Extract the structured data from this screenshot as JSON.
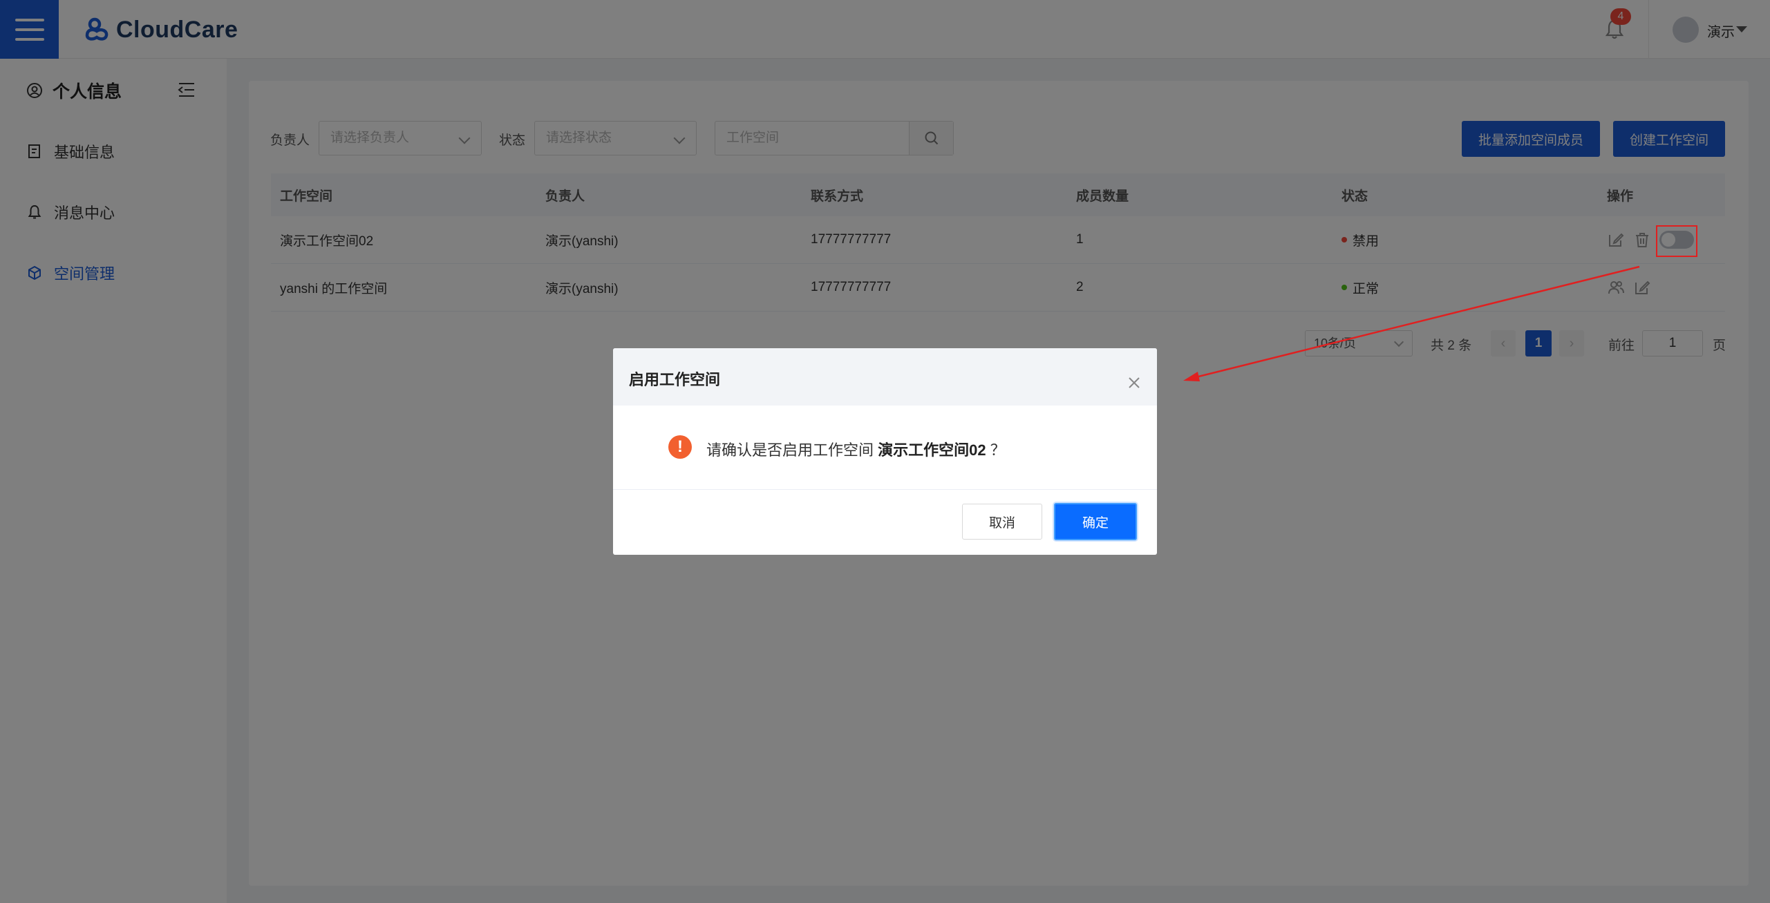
{
  "header": {
    "brand": "CloudCare",
    "notification_count": "4",
    "user_name": "演示"
  },
  "sidebar": {
    "title": "个人信息",
    "items": [
      {
        "label": "基础信息",
        "icon": "edit-doc-icon",
        "active": false
      },
      {
        "label": "消息中心",
        "icon": "bell-icon",
        "active": false
      },
      {
        "label": "空间管理",
        "icon": "cube-icon",
        "active": true
      }
    ]
  },
  "filters": {
    "owner_label": "负责人",
    "owner_placeholder": "请选择负责人",
    "status_label": "状态",
    "status_placeholder": "请选择状态",
    "search_placeholder": "工作空间"
  },
  "actions": {
    "batch_add_label": "批量添加空间成员",
    "create_label": "创建工作空间"
  },
  "table": {
    "columns": [
      "工作空间",
      "负责人",
      "联系方式",
      "成员数量",
      "状态",
      "操作"
    ],
    "rows": [
      {
        "workspace": "演示工作空间02",
        "owner": "演示(yanshi)",
        "contact": "17777777777",
        "members": "1",
        "status": "禁用",
        "status_color": "#f5483b"
      },
      {
        "workspace": "yanshi 的工作空间",
        "owner": "演示(yanshi)",
        "contact": "17777777777",
        "members": "2",
        "status": "正常",
        "status_color": "#52c41a"
      }
    ]
  },
  "pagination": {
    "page_size": "10条/页",
    "total": "共 2 条",
    "current_page": "1",
    "goto_label": "前往",
    "goto_value": "1",
    "page_suffix": "页"
  },
  "dialog": {
    "title": "启用工作空间",
    "message_prefix": "请确认是否启用工作空间",
    "workspace_name": "演示工作空间02",
    "message_suffix": "？",
    "cancel_label": "取消",
    "confirm_label": "确定"
  },
  "colors": {
    "primary": "#1c5dd6",
    "warning": "#f2602f",
    "annotation": "#e02020"
  }
}
